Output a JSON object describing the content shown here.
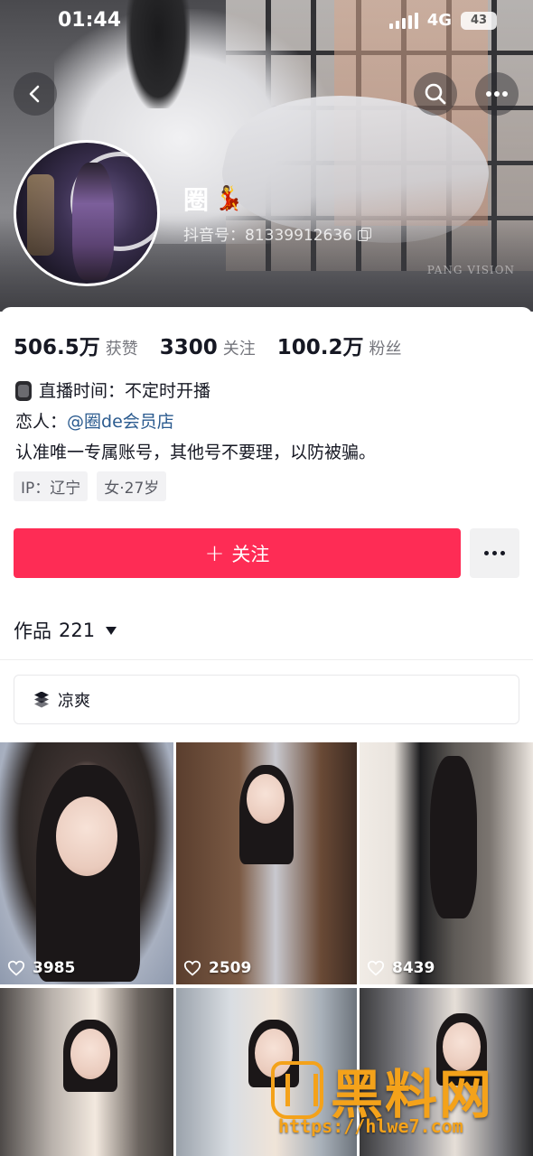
{
  "status_bar": {
    "time": "01:44",
    "network": "4G",
    "battery": "43"
  },
  "header": {
    "back_icon": "chevron-left-icon",
    "search_icon": "search-icon",
    "more_icon": "more-horizontal-icon",
    "cover_watermark": "PANG VISION"
  },
  "profile": {
    "nickname": "圈",
    "nickname_emoji": "💃",
    "douyin_id": "抖音号：81339912636",
    "copy_icon": "copy-icon"
  },
  "stats": [
    {
      "value": "506.5万",
      "label": "获赞"
    },
    {
      "value": "3300",
      "label": "关注"
    },
    {
      "value": "100.2万",
      "label": "粉丝"
    }
  ],
  "bio": {
    "line1": "直播时间：不定时开播",
    "line2_prefix": "恋人：",
    "line2_mention": "@圈de会员店",
    "line3": "认准唯一专属账号，其他号不要理，以防被骗。"
  },
  "tags": [
    "IP：辽宁",
    "女·27岁"
  ],
  "actions": {
    "follow_label": "关注",
    "follow_icon": "plus-icon",
    "more_icon": "more-horizontal-icon",
    "follow_color": "#fe2c55"
  },
  "works": {
    "label": "作品",
    "count": "221"
  },
  "collection": {
    "label": "凉爽",
    "icon": "layers-icon"
  },
  "videos": [
    {
      "likes": "3985"
    },
    {
      "likes": "2509"
    },
    {
      "likes": "8439"
    },
    {
      "likes": ""
    },
    {
      "likes": ""
    },
    {
      "likes": ""
    }
  ],
  "site_watermark": {
    "title": "黑料网",
    "url": "https://hlwe7.com"
  }
}
